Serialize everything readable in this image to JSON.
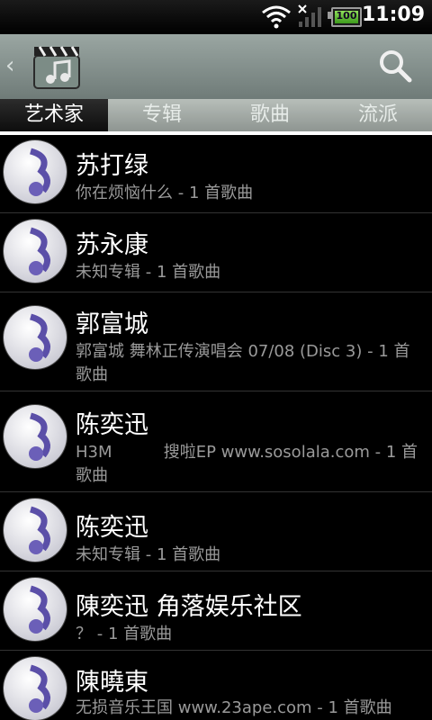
{
  "status_bar": {
    "time": "11:09",
    "battery": "100"
  },
  "header": {
    "back_icon": "chevron-left-icon",
    "app_icon": "music-clapper-icon",
    "search_icon": "search-icon"
  },
  "tabs": [
    {
      "label": "艺术家",
      "active": true
    },
    {
      "label": "专辑",
      "active": false
    },
    {
      "label": "歌曲",
      "active": false
    },
    {
      "label": "流派",
      "active": false
    }
  ],
  "artists": [
    {
      "name": "苏打绿",
      "detail": "你在烦恼什么 - 1 首歌曲"
    },
    {
      "name": "苏永康",
      "detail": "未知专辑 - 1 首歌曲"
    },
    {
      "name": "郭富城",
      "detail": "郭富城 舞林正传演唱会 07/08 (Disc 3) - 1 首歌曲"
    },
    {
      "name": "陈奕迅",
      "detail": "H3M          搜啦EP www.sosolala.com - 1 首歌曲"
    },
    {
      "name": "陈奕迅",
      "detail": "未知专辑 - 1 首歌曲"
    },
    {
      "name": "陳奕迅 角落娱乐社区",
      "detail": "？ - 1 首歌曲"
    },
    {
      "name": "陳曉東",
      "detail": "无损音乐王国 www.23ape.com - 1 首歌曲"
    }
  ]
}
